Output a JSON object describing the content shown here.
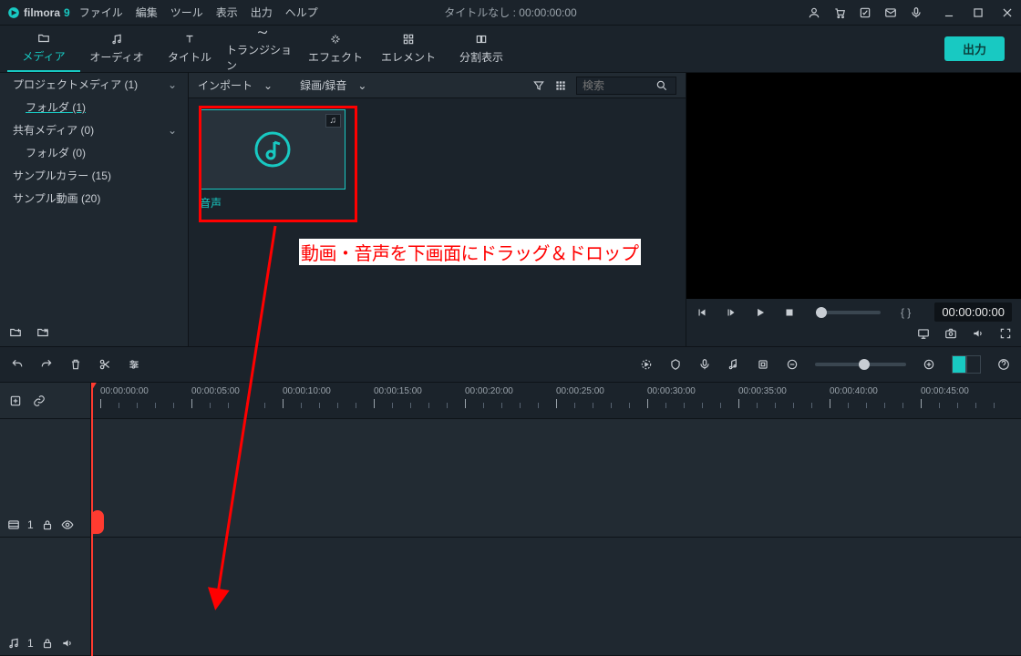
{
  "app": {
    "name": "filmora",
    "version": "9"
  },
  "menubar": [
    "ファイル",
    "編集",
    "ツール",
    "表示",
    "出力",
    "ヘルプ"
  ],
  "title_center": "タイトルなし : 00:00:00:00",
  "ribbon": {
    "tabs": [
      {
        "label": "メディア"
      },
      {
        "label": "オーディオ"
      },
      {
        "label": "タイトル"
      },
      {
        "label": "トランジション"
      },
      {
        "label": "エフェクト"
      },
      {
        "label": "エレメント"
      },
      {
        "label": "分割表示"
      }
    ],
    "export": "出力"
  },
  "sidebar": {
    "items": [
      {
        "label": "プロジェクトメディア (1)",
        "indent": 0,
        "expandable": true
      },
      {
        "label": "フォルダ (1)",
        "indent": 1,
        "active": true
      },
      {
        "label": "共有メディア (0)",
        "indent": 0,
        "expandable": true
      },
      {
        "label": "フォルダ (0)",
        "indent": 1
      },
      {
        "label": "サンプルカラー (15)",
        "indent": 0
      },
      {
        "label": "サンプル動画 (20)",
        "indent": 0
      }
    ]
  },
  "media_toolbar": {
    "import": "インポート",
    "record": "録画/録音",
    "search_placeholder": "検索"
  },
  "media_card": {
    "badge": "♫",
    "label": "音声"
  },
  "annotation": {
    "text": "動画・音声を下画面にドラッグ＆ドロップ"
  },
  "preview": {
    "markers": "{  }",
    "timecode": "00:00:00:00"
  },
  "ruler_labels": [
    "00:00:00:00",
    "00:00:05:00",
    "00:00:10:00",
    "00:00:15:00",
    "00:00:20:00",
    "00:00:25:00",
    "00:00:30:00",
    "00:00:35:00",
    "00:00:40:00",
    "00:00:45:00"
  ],
  "track_video_num": "1",
  "track_audio_num": "1"
}
